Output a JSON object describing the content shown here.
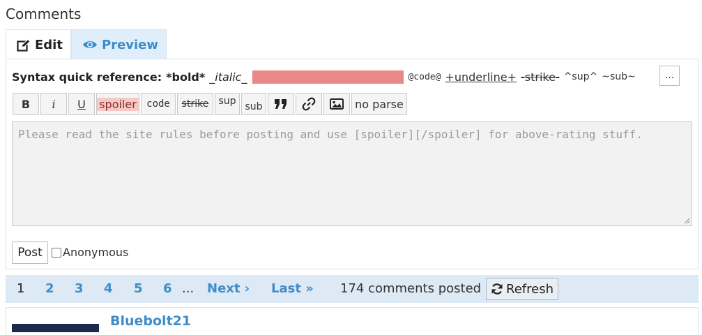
{
  "heading": "Comments",
  "tabs": {
    "edit": "Edit",
    "preview": "Preview"
  },
  "syntax_ref": {
    "label": "Syntax quick reference:",
    "bold": "*bold*",
    "italic": "_italic_",
    "code": "@code@",
    "underline": "+underline+",
    "strike": "-strike-",
    "sup": "^sup^",
    "sub": "~sub~",
    "more": "..."
  },
  "toolbar": {
    "bold": "B",
    "italic": "i",
    "underline": "U",
    "spoiler": "spoiler",
    "code": "code",
    "strike": "strike",
    "sup": "sup",
    "sub": "sub",
    "no_parse": "no parse"
  },
  "comment_field": {
    "placeholder": "Please read the site rules before posting and use [spoiler][/spoiler] for above-rating stuff."
  },
  "post_button": "Post",
  "anonymous_label": "Anonymous",
  "pagination": {
    "pages": [
      "1",
      "2",
      "3",
      "4",
      "5",
      "6"
    ],
    "ellipsis": "...",
    "next": "Next ›",
    "last": "Last »",
    "count_text": "174 comments posted",
    "refresh": "Refresh"
  },
  "comment": {
    "author": "Bluebolt21"
  },
  "colors": {
    "accent": "#3f8cc8",
    "pager_bg": "#dde9f5",
    "spoiler_bar": "#e88888"
  }
}
